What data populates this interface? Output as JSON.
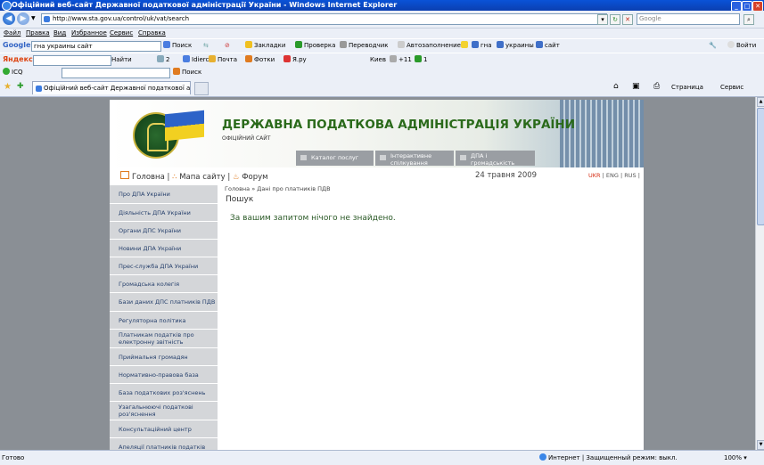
{
  "window": {
    "title": "Офіційний веб-сайт Державної податкової адміністрації України - Windows Internet Explorer"
  },
  "address_bar": {
    "url": "http://www.sta.gov.ua/control/uk/vat/search",
    "search_placeholder": "Google"
  },
  "menu": [
    "Файл",
    "Правка",
    "Вид",
    "Избранное",
    "Сервис",
    "Справка"
  ],
  "google_toolbar": {
    "logo": "Google",
    "query": "гна украины сайт",
    "items": [
      "Поиск",
      "Закладки",
      "Проверка",
      "Переводчик",
      "Автозаполнение",
      "гна",
      "украины",
      "сайт",
      "Войти"
    ]
  },
  "yandex_toolbar": {
    "logo": "Яндекс",
    "items": [
      "Найти",
      "2",
      "Idierc",
      "Почта",
      "Фотки",
      "Я.ру",
      "Киев",
      "+11",
      "1"
    ]
  },
  "icq_toolbar": {
    "logo": "ICQ",
    "items": [
      "Поиск"
    ]
  },
  "tab": {
    "title": "Офіційний веб-сайт Державної податкової адміністр..."
  },
  "command_bar": {
    "page": "Страница",
    "service": "Сервис"
  },
  "site": {
    "title": "ДЕРЖАВНА ПОДАТКОВА АДМІНІСТРАЦІЯ УКРАЇНИ",
    "subtitle": "ОФІЦІЙНИЙ САЙТ",
    "banner_tabs": [
      "Каталог послуг",
      "Інтерактивне спілкування",
      "ДПА і громадськість"
    ],
    "nav": {
      "home": "Головна",
      "sitemap": "Мапа сайту",
      "forum": "Форум",
      "sep": "|"
    },
    "date": "24 травня 2009",
    "langs": [
      "UKR",
      "ENG",
      "RUS"
    ],
    "sidebar": [
      "Про ДПА України",
      "Діяльність ДПА України",
      "Органи ДПС України",
      "Новини ДПА України",
      "Прес-служба ДПА України",
      "Громадська колегія",
      "Бази даних ДПС платників ПДВ",
      "Регуляторна політика",
      "Платникам податків про електронну звітність",
      "Приймальня громадян",
      "Нормативно-правова база",
      "База податкових роз'яснень",
      "Узагальнюючі податкові роз'яснення",
      "Консультаційний центр",
      "Апеляції платників податків"
    ],
    "breadcrumb": "Головна »  Дані про платників ПДВ",
    "page_title": "Пошук",
    "result_text": "За вашим запитом нічого не знайдено."
  },
  "status_bar": {
    "left": "Готово",
    "zone": "Интернет | Защищенный режим: выкл.",
    "zoom": "100%"
  },
  "colors": {
    "title_bar": "#0b3fb0",
    "site_title": "#2a6a1a",
    "sidebar_bg": "#d4d6d9",
    "page_bg": "#8a8f95",
    "lang_active": "#d62e14"
  }
}
